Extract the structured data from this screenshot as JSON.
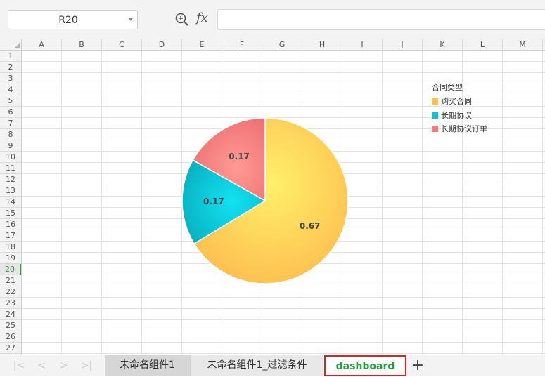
{
  "formula_bar": {
    "name_box": "R20",
    "fx_label": "fx",
    "formula": ""
  },
  "columns": [
    "A",
    "B",
    "C",
    "D",
    "E",
    "F",
    "G",
    "H",
    "I",
    "J",
    "K",
    "L",
    "M"
  ],
  "rows": [
    "1",
    "2",
    "3",
    "4",
    "5",
    "6",
    "7",
    "8",
    "9",
    "10",
    "11",
    "12",
    "13",
    "14",
    "15",
    "16",
    "17",
    "18",
    "19",
    "20",
    "21",
    "22",
    "23",
    "24",
    "25",
    "26",
    "27"
  ],
  "active_row": "20",
  "chart_data": {
    "type": "pie",
    "title": "",
    "legend_title": "合同类型",
    "legend_position": "top-right",
    "labels": [
      "购买合同",
      "长期协议",
      "长期协议订单"
    ],
    "values": [
      0.67,
      0.17,
      0.17
    ],
    "data_labels": [
      "0.67",
      "0.17",
      "0.17"
    ],
    "colors": [
      "#fcc250",
      "#1bbcd0",
      "#f47e7e"
    ]
  },
  "sheet_tabs": [
    "未命名组件1",
    "未命名组件1_过滤条件",
    "dashboard"
  ],
  "active_tab": "dashboard",
  "colors": {
    "accent": "#2e9b46",
    "highlight_border": "#e02020"
  }
}
